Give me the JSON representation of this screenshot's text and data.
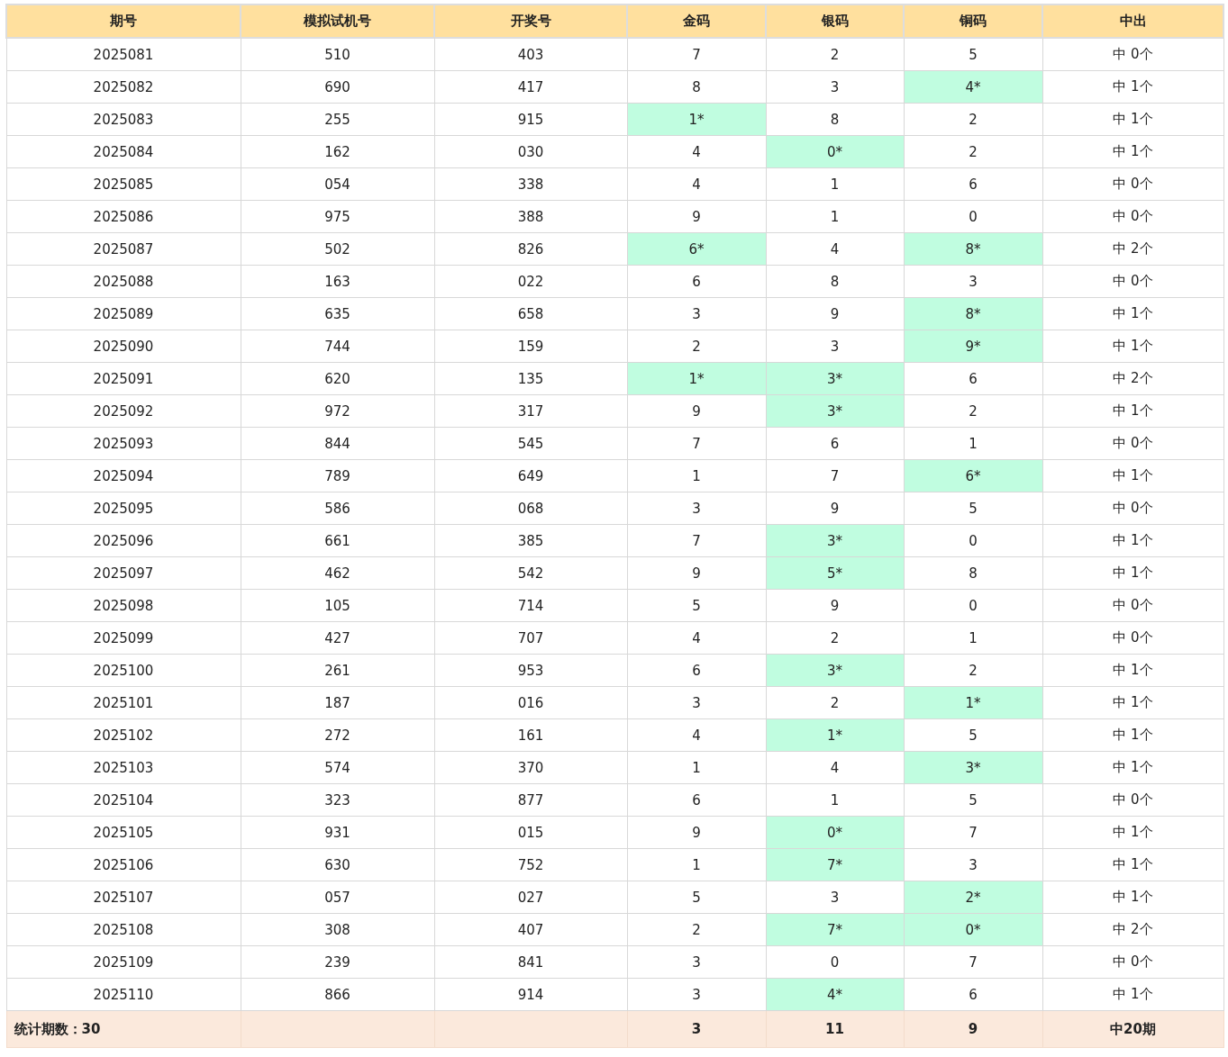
{
  "table": {
    "columns": [
      "期号",
      "模拟试机号",
      "开奖号",
      "金码",
      "银码",
      "铜码",
      "中出"
    ],
    "rows": [
      {
        "cells": [
          {
            "text": "2025081",
            "hit": false
          },
          {
            "text": "510",
            "hit": false
          },
          {
            "text": "403",
            "hit": false
          },
          {
            "text": "7",
            "hit": false
          },
          {
            "text": "2",
            "hit": false
          },
          {
            "text": "5",
            "hit": false
          },
          {
            "text": "中 0个",
            "hit": false
          }
        ]
      },
      {
        "cells": [
          {
            "text": "2025082",
            "hit": false
          },
          {
            "text": "690",
            "hit": false
          },
          {
            "text": "417",
            "hit": false
          },
          {
            "text": "8",
            "hit": false
          },
          {
            "text": "3",
            "hit": false
          },
          {
            "text": "4*",
            "hit": true
          },
          {
            "text": "中 1个",
            "hit": false
          }
        ]
      },
      {
        "cells": [
          {
            "text": "2025083",
            "hit": false
          },
          {
            "text": "255",
            "hit": false
          },
          {
            "text": "915",
            "hit": false
          },
          {
            "text": "1*",
            "hit": true
          },
          {
            "text": "8",
            "hit": false
          },
          {
            "text": "2",
            "hit": false
          },
          {
            "text": "中 1个",
            "hit": false
          }
        ]
      },
      {
        "cells": [
          {
            "text": "2025084",
            "hit": false
          },
          {
            "text": "162",
            "hit": false
          },
          {
            "text": "030",
            "hit": false
          },
          {
            "text": "4",
            "hit": false
          },
          {
            "text": "0*",
            "hit": true
          },
          {
            "text": "2",
            "hit": false
          },
          {
            "text": "中 1个",
            "hit": false
          }
        ]
      },
      {
        "cells": [
          {
            "text": "2025085",
            "hit": false
          },
          {
            "text": "054",
            "hit": false
          },
          {
            "text": "338",
            "hit": false
          },
          {
            "text": "4",
            "hit": false
          },
          {
            "text": "1",
            "hit": false
          },
          {
            "text": "6",
            "hit": false
          },
          {
            "text": "中 0个",
            "hit": false
          }
        ]
      },
      {
        "cells": [
          {
            "text": "2025086",
            "hit": false
          },
          {
            "text": "975",
            "hit": false
          },
          {
            "text": "388",
            "hit": false
          },
          {
            "text": "9",
            "hit": false
          },
          {
            "text": "1",
            "hit": false
          },
          {
            "text": "0",
            "hit": false
          },
          {
            "text": "中 0个",
            "hit": false
          }
        ]
      },
      {
        "cells": [
          {
            "text": "2025087",
            "hit": false
          },
          {
            "text": "502",
            "hit": false
          },
          {
            "text": "826",
            "hit": false
          },
          {
            "text": "6*",
            "hit": true
          },
          {
            "text": "4",
            "hit": false
          },
          {
            "text": "8*",
            "hit": true
          },
          {
            "text": "中 2个",
            "hit": false
          }
        ]
      },
      {
        "cells": [
          {
            "text": "2025088",
            "hit": false
          },
          {
            "text": "163",
            "hit": false
          },
          {
            "text": "022",
            "hit": false
          },
          {
            "text": "6",
            "hit": false
          },
          {
            "text": "8",
            "hit": false
          },
          {
            "text": "3",
            "hit": false
          },
          {
            "text": "中 0个",
            "hit": false
          }
        ]
      },
      {
        "cells": [
          {
            "text": "2025089",
            "hit": false
          },
          {
            "text": "635",
            "hit": false
          },
          {
            "text": "658",
            "hit": false
          },
          {
            "text": "3",
            "hit": false
          },
          {
            "text": "9",
            "hit": false
          },
          {
            "text": "8*",
            "hit": true
          },
          {
            "text": "中 1个",
            "hit": false
          }
        ]
      },
      {
        "cells": [
          {
            "text": "2025090",
            "hit": false
          },
          {
            "text": "744",
            "hit": false
          },
          {
            "text": "159",
            "hit": false
          },
          {
            "text": "2",
            "hit": false
          },
          {
            "text": "3",
            "hit": false
          },
          {
            "text": "9*",
            "hit": true
          },
          {
            "text": "中 1个",
            "hit": false
          }
        ]
      },
      {
        "cells": [
          {
            "text": "2025091",
            "hit": false
          },
          {
            "text": "620",
            "hit": false
          },
          {
            "text": "135",
            "hit": false
          },
          {
            "text": "1*",
            "hit": true
          },
          {
            "text": "3*",
            "hit": true
          },
          {
            "text": "6",
            "hit": false
          },
          {
            "text": "中 2个",
            "hit": false
          }
        ]
      },
      {
        "cells": [
          {
            "text": "2025092",
            "hit": false
          },
          {
            "text": "972",
            "hit": false
          },
          {
            "text": "317",
            "hit": false
          },
          {
            "text": "9",
            "hit": false
          },
          {
            "text": "3*",
            "hit": true
          },
          {
            "text": "2",
            "hit": false
          },
          {
            "text": "中 1个",
            "hit": false
          }
        ]
      },
      {
        "cells": [
          {
            "text": "2025093",
            "hit": false
          },
          {
            "text": "844",
            "hit": false
          },
          {
            "text": "545",
            "hit": false
          },
          {
            "text": "7",
            "hit": false
          },
          {
            "text": "6",
            "hit": false
          },
          {
            "text": "1",
            "hit": false
          },
          {
            "text": "中 0个",
            "hit": false
          }
        ]
      },
      {
        "cells": [
          {
            "text": "2025094",
            "hit": false
          },
          {
            "text": "789",
            "hit": false
          },
          {
            "text": "649",
            "hit": false
          },
          {
            "text": "1",
            "hit": false
          },
          {
            "text": "7",
            "hit": false
          },
          {
            "text": "6*",
            "hit": true
          },
          {
            "text": "中 1个",
            "hit": false
          }
        ]
      },
      {
        "cells": [
          {
            "text": "2025095",
            "hit": false
          },
          {
            "text": "586",
            "hit": false
          },
          {
            "text": "068",
            "hit": false
          },
          {
            "text": "3",
            "hit": false
          },
          {
            "text": "9",
            "hit": false
          },
          {
            "text": "5",
            "hit": false
          },
          {
            "text": "中 0个",
            "hit": false
          }
        ]
      },
      {
        "cells": [
          {
            "text": "2025096",
            "hit": false
          },
          {
            "text": "661",
            "hit": false
          },
          {
            "text": "385",
            "hit": false
          },
          {
            "text": "7",
            "hit": false
          },
          {
            "text": "3*",
            "hit": true
          },
          {
            "text": "0",
            "hit": false
          },
          {
            "text": "中 1个",
            "hit": false
          }
        ]
      },
      {
        "cells": [
          {
            "text": "2025097",
            "hit": false
          },
          {
            "text": "462",
            "hit": false
          },
          {
            "text": "542",
            "hit": false
          },
          {
            "text": "9",
            "hit": false
          },
          {
            "text": "5*",
            "hit": true
          },
          {
            "text": "8",
            "hit": false
          },
          {
            "text": "中 1个",
            "hit": false
          }
        ]
      },
      {
        "cells": [
          {
            "text": "2025098",
            "hit": false
          },
          {
            "text": "105",
            "hit": false
          },
          {
            "text": "714",
            "hit": false
          },
          {
            "text": "5",
            "hit": false
          },
          {
            "text": "9",
            "hit": false
          },
          {
            "text": "0",
            "hit": false
          },
          {
            "text": "中 0个",
            "hit": false
          }
        ]
      },
      {
        "cells": [
          {
            "text": "2025099",
            "hit": false
          },
          {
            "text": "427",
            "hit": false
          },
          {
            "text": "707",
            "hit": false
          },
          {
            "text": "4",
            "hit": false
          },
          {
            "text": "2",
            "hit": false
          },
          {
            "text": "1",
            "hit": false
          },
          {
            "text": "中 0个",
            "hit": false
          }
        ]
      },
      {
        "cells": [
          {
            "text": "2025100",
            "hit": false
          },
          {
            "text": "261",
            "hit": false
          },
          {
            "text": "953",
            "hit": false
          },
          {
            "text": "6",
            "hit": false
          },
          {
            "text": "3*",
            "hit": true
          },
          {
            "text": "2",
            "hit": false
          },
          {
            "text": "中 1个",
            "hit": false
          }
        ]
      },
      {
        "cells": [
          {
            "text": "2025101",
            "hit": false
          },
          {
            "text": "187",
            "hit": false
          },
          {
            "text": "016",
            "hit": false
          },
          {
            "text": "3",
            "hit": false
          },
          {
            "text": "2",
            "hit": false
          },
          {
            "text": "1*",
            "hit": true
          },
          {
            "text": "中 1个",
            "hit": false
          }
        ]
      },
      {
        "cells": [
          {
            "text": "2025102",
            "hit": false
          },
          {
            "text": "272",
            "hit": false
          },
          {
            "text": "161",
            "hit": false
          },
          {
            "text": "4",
            "hit": false
          },
          {
            "text": "1*",
            "hit": true
          },
          {
            "text": "5",
            "hit": false
          },
          {
            "text": "中 1个",
            "hit": false
          }
        ]
      },
      {
        "cells": [
          {
            "text": "2025103",
            "hit": false
          },
          {
            "text": "574",
            "hit": false
          },
          {
            "text": "370",
            "hit": false
          },
          {
            "text": "1",
            "hit": false
          },
          {
            "text": "4",
            "hit": false
          },
          {
            "text": "3*",
            "hit": true
          },
          {
            "text": "中 1个",
            "hit": false
          }
        ]
      },
      {
        "cells": [
          {
            "text": "2025104",
            "hit": false
          },
          {
            "text": "323",
            "hit": false
          },
          {
            "text": "877",
            "hit": false
          },
          {
            "text": "6",
            "hit": false
          },
          {
            "text": "1",
            "hit": false
          },
          {
            "text": "5",
            "hit": false
          },
          {
            "text": "中 0个",
            "hit": false
          }
        ]
      },
      {
        "cells": [
          {
            "text": "2025105",
            "hit": false
          },
          {
            "text": "931",
            "hit": false
          },
          {
            "text": "015",
            "hit": false
          },
          {
            "text": "9",
            "hit": false
          },
          {
            "text": "0*",
            "hit": true
          },
          {
            "text": "7",
            "hit": false
          },
          {
            "text": "中 1个",
            "hit": false
          }
        ]
      },
      {
        "cells": [
          {
            "text": "2025106",
            "hit": false
          },
          {
            "text": "630",
            "hit": false
          },
          {
            "text": "752",
            "hit": false
          },
          {
            "text": "1",
            "hit": false
          },
          {
            "text": "7*",
            "hit": true
          },
          {
            "text": "3",
            "hit": false
          },
          {
            "text": "中 1个",
            "hit": false
          }
        ]
      },
      {
        "cells": [
          {
            "text": "2025107",
            "hit": false
          },
          {
            "text": "057",
            "hit": false
          },
          {
            "text": "027",
            "hit": false
          },
          {
            "text": "5",
            "hit": false
          },
          {
            "text": "3",
            "hit": false
          },
          {
            "text": "2*",
            "hit": true
          },
          {
            "text": "中 1个",
            "hit": false
          }
        ]
      },
      {
        "cells": [
          {
            "text": "2025108",
            "hit": false
          },
          {
            "text": "308",
            "hit": false
          },
          {
            "text": "407",
            "hit": false
          },
          {
            "text": "2",
            "hit": false
          },
          {
            "text": "7*",
            "hit": true
          },
          {
            "text": "0*",
            "hit": true
          },
          {
            "text": "中 2个",
            "hit": false
          }
        ]
      },
      {
        "cells": [
          {
            "text": "2025109",
            "hit": false
          },
          {
            "text": "239",
            "hit": false
          },
          {
            "text": "841",
            "hit": false
          },
          {
            "text": "3",
            "hit": false
          },
          {
            "text": "0",
            "hit": false
          },
          {
            "text": "7",
            "hit": false
          },
          {
            "text": "中 0个",
            "hit": false
          }
        ]
      },
      {
        "cells": [
          {
            "text": "2025110",
            "hit": false
          },
          {
            "text": "866",
            "hit": false
          },
          {
            "text": "914",
            "hit": false
          },
          {
            "text": "3",
            "hit": false
          },
          {
            "text": "4*",
            "hit": true
          },
          {
            "text": "6",
            "hit": false
          },
          {
            "text": "中 1个",
            "hit": false
          }
        ]
      }
    ],
    "footer": {
      "label": "统计期数：30",
      "gold": "3",
      "silver": "11",
      "copper": "9",
      "total": "中20期"
    }
  }
}
